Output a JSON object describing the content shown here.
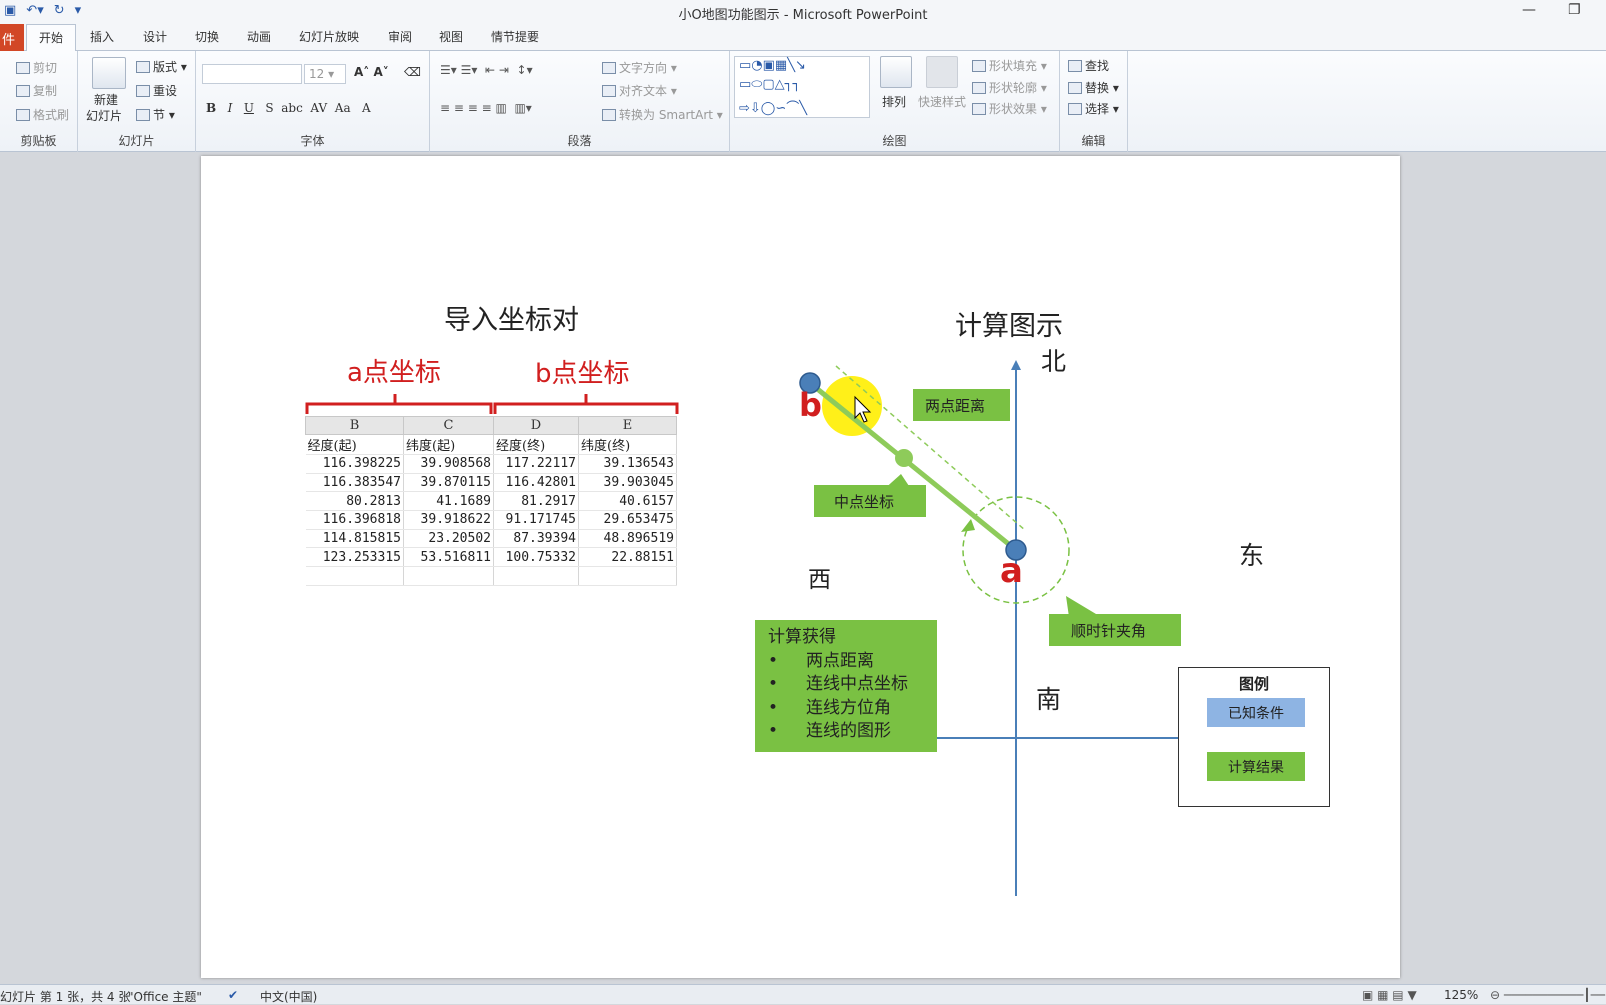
{
  "window": {
    "title": "小O地图功能图示 - Microsoft PowerPoint",
    "file_tab": "件",
    "minimize": "—",
    "restore": "❐"
  },
  "tabs": [
    "开始",
    "插入",
    "设计",
    "切换",
    "动画",
    "幻灯片放映",
    "审阅",
    "视图",
    "情节提要"
  ],
  "ribbon": {
    "clipboard": {
      "cut": "剪切",
      "copy": "复制",
      "format_painter": "格式刷",
      "label": "剪贴板"
    },
    "slides": {
      "new_slide_1": "新建",
      "new_slide_2": "幻灯片",
      "layout": "版式",
      "reset": "重设",
      "section": "节",
      "label": "幻灯片"
    },
    "font": {
      "size": "12",
      "label": "字体"
    },
    "paragraph": {
      "text_direction": "文字方向",
      "align_text": "对齐文本",
      "smartart": "转换为 SmartArt",
      "label": "段落"
    },
    "drawing": {
      "arrange": "排列",
      "quick_styles": "快速样式",
      "shape_fill": "形状填充",
      "shape_outline": "形状轮廓",
      "shape_effects": "形状效果",
      "label": "绘图"
    },
    "editing": {
      "find": "查找",
      "replace": "替换",
      "select": "选择",
      "label": "编辑"
    }
  },
  "slide": {
    "left_title": "导入坐标对",
    "a_label": "a点坐标",
    "b_label": "b点坐标",
    "table": {
      "columns": [
        "B",
        "C",
        "D",
        "E"
      ],
      "header": [
        "经度(起)",
        "纬度(起)",
        "经度(终)",
        "纬度(终)"
      ],
      "rows": [
        [
          "116.398225",
          "39.908568",
          "117.22117",
          "39.136543"
        ],
        [
          "116.383547",
          "39.870115",
          "116.42801",
          "39.903045"
        ],
        [
          "80.2813",
          "41.1689",
          "81.2917",
          "40.6157"
        ],
        [
          "116.396818",
          "39.918622",
          "91.171745",
          "29.653475"
        ],
        [
          "114.815815",
          "23.20502",
          "87.39394",
          "48.896519"
        ],
        [
          "123.253315",
          "53.516811",
          "100.75332",
          "22.88151"
        ]
      ]
    },
    "right_title": "计算图示",
    "north": "北",
    "south": "南",
    "east": "东",
    "west": "西",
    "point_a": "a",
    "point_b": "b",
    "distance_label": "两点距离",
    "midpoint_label": "中点坐标",
    "angle_label": "顺时针夹角",
    "results_title": "计算获得",
    "results_items": [
      "两点距离",
      "连线中点坐标",
      "连线方位角",
      "连线的图形"
    ],
    "legend_title": "图例",
    "legend_known": "已知条件",
    "legend_result": "计算结果"
  },
  "status": {
    "slide_info": "幻灯片 第 1 张，共 4 张",
    "theme": "\"Office 主题\"",
    "language": "中文(中国)",
    "zoom": "125%"
  },
  "colors": {
    "accent_red": "#d11f1f",
    "green": "#7ac143",
    "axis_blue": "#4a7fb8",
    "legend_blue": "#8eb4e3"
  }
}
